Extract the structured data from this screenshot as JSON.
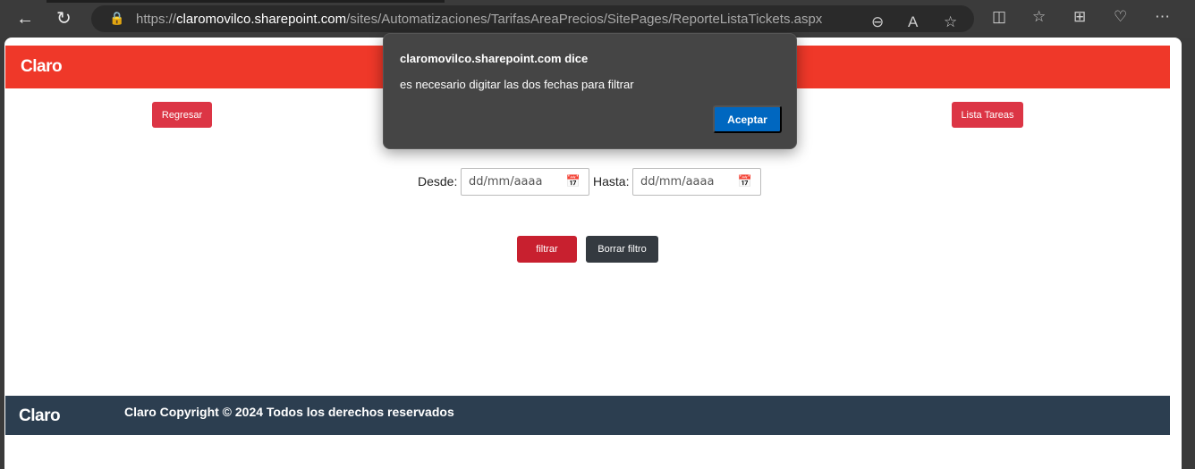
{
  "browser": {
    "url_prefix": "https://",
    "url_domain": "claromovilco.sharepoint.com",
    "url_path": "/sites/Automatizaciones/TarifasAreaPrecios/SitePages/ReporteListaTickets.aspx",
    "icons": [
      "back-icon",
      "refresh-icon",
      "lock-icon",
      "zoom-out-icon",
      "read-aloud-icon",
      "favorite-star-icon",
      "split-screen-icon",
      "favorites-icon",
      "collections-icon",
      "browser-essentials-icon",
      "more-icon"
    ]
  },
  "header": {
    "logo": "Claro"
  },
  "buttons": {
    "back": "Regresar",
    "task_list": "Lista Tareas",
    "filter": "filtrar",
    "clear_filter": "Borrar filtro"
  },
  "filters": {
    "from_label": "Desde:",
    "from_placeholder": "dd/mm/aaaa",
    "to_label": "Hasta:",
    "to_placeholder": "dd/mm/aaaa"
  },
  "footer": {
    "logo": "Claro",
    "copyright": "Claro Copyright © 2024 Todos los derechos reservados"
  },
  "dialog": {
    "title": "claromovilco.sharepoint.com dice",
    "message": "es necesario digitar las dos fechas para filtrar",
    "ok": "Aceptar"
  },
  "colors": {
    "brand_red": "#ef3829",
    "button_red": "#dc3545",
    "footer": "#2c3e50",
    "dialog_accept": "#0067c0"
  }
}
